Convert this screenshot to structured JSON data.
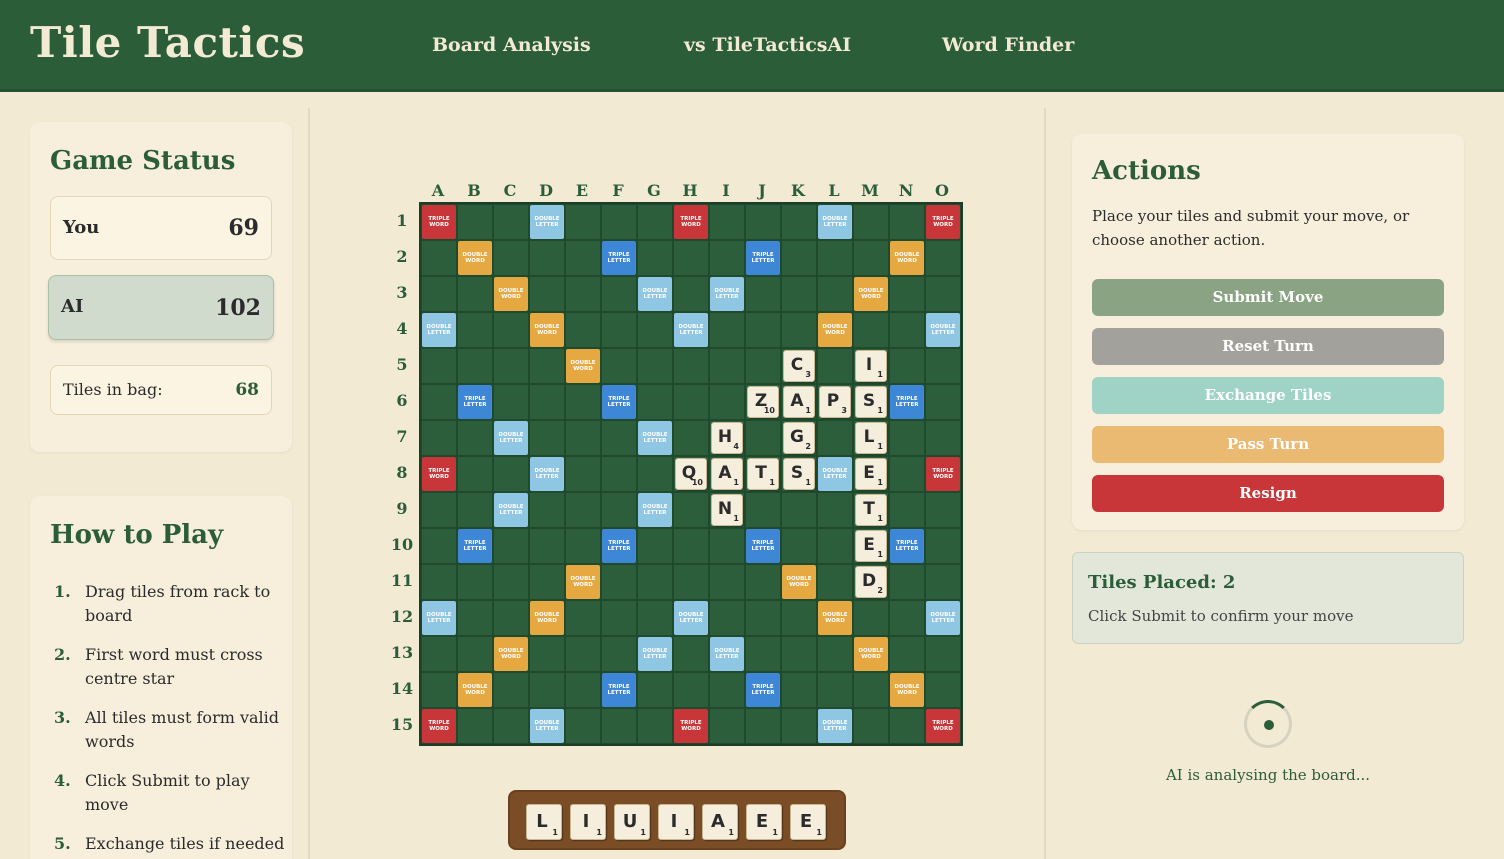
{
  "header": {
    "logo": "Tile Tactics",
    "nav": [
      "Board Analysis",
      "vs TileTacticsAI",
      "Word Finder"
    ]
  },
  "game_status": {
    "title": "Game Status",
    "you_label": "You",
    "you_score": "69",
    "ai_label": "AI",
    "ai_score": "102",
    "bag_label": "Tiles in bag:",
    "bag_count": "68"
  },
  "how_to_play": {
    "title": "How to Play",
    "steps": [
      {
        "num": "1.",
        "text": "Drag tiles from rack to board"
      },
      {
        "num": "2.",
        "text": "First word must cross centre star"
      },
      {
        "num": "3.",
        "text": "All tiles must form valid words"
      },
      {
        "num": "4.",
        "text": "Click Submit to play move"
      },
      {
        "num": "5.",
        "text": "Exchange tiles if needed (lose turn)"
      }
    ]
  },
  "board": {
    "columns": [
      "A",
      "B",
      "C",
      "D",
      "E",
      "F",
      "G",
      "H",
      "I",
      "J",
      "K",
      "L",
      "M",
      "N",
      "O"
    ],
    "rows": [
      "1",
      "2",
      "3",
      "4",
      "5",
      "6",
      "7",
      "8",
      "9",
      "10",
      "11",
      "12",
      "13",
      "14",
      "15"
    ],
    "premium_labels": {
      "TW": [
        "TRIPLE",
        "WORD"
      ],
      "DW": [
        "DOUBLE",
        "WORD"
      ],
      "TL": [
        "TRIPLE",
        "LETTER"
      ],
      "DL": [
        "DOUBLE",
        "LETTER"
      ]
    },
    "premium_colors": {
      "TW": "#c9363a",
      "DW": "#e6a840",
      "TL": "#3e86d6",
      "DL": "#8ec6e4"
    },
    "premium_squares": [
      {
        "cell": "A1",
        "type": "TW"
      },
      {
        "cell": "D1",
        "type": "DL"
      },
      {
        "cell": "H1",
        "type": "TW"
      },
      {
        "cell": "L1",
        "type": "DL"
      },
      {
        "cell": "O1",
        "type": "TW"
      },
      {
        "cell": "B2",
        "type": "DW"
      },
      {
        "cell": "F2",
        "type": "TL"
      },
      {
        "cell": "J2",
        "type": "TL"
      },
      {
        "cell": "N2",
        "type": "DW"
      },
      {
        "cell": "C3",
        "type": "DW"
      },
      {
        "cell": "G3",
        "type": "DL"
      },
      {
        "cell": "I3",
        "type": "DL"
      },
      {
        "cell": "M3",
        "type": "DW"
      },
      {
        "cell": "A4",
        "type": "DL"
      },
      {
        "cell": "D4",
        "type": "DW"
      },
      {
        "cell": "H4",
        "type": "DL"
      },
      {
        "cell": "L4",
        "type": "DW"
      },
      {
        "cell": "O4",
        "type": "DL"
      },
      {
        "cell": "E5",
        "type": "DW"
      },
      {
        "cell": "B6",
        "type": "TL"
      },
      {
        "cell": "F6",
        "type": "TL"
      },
      {
        "cell": "N6",
        "type": "TL"
      },
      {
        "cell": "C7",
        "type": "DL"
      },
      {
        "cell": "G7",
        "type": "DL"
      },
      {
        "cell": "A8",
        "type": "TW"
      },
      {
        "cell": "D8",
        "type": "DL"
      },
      {
        "cell": "L8",
        "type": "DL"
      },
      {
        "cell": "O8",
        "type": "TW"
      },
      {
        "cell": "C9",
        "type": "DL"
      },
      {
        "cell": "G9",
        "type": "DL"
      },
      {
        "cell": "B10",
        "type": "TL"
      },
      {
        "cell": "F10",
        "type": "TL"
      },
      {
        "cell": "J10",
        "type": "TL"
      },
      {
        "cell": "N10",
        "type": "TL"
      },
      {
        "cell": "E11",
        "type": "DW"
      },
      {
        "cell": "K11",
        "type": "DW"
      },
      {
        "cell": "A12",
        "type": "DL"
      },
      {
        "cell": "D12",
        "type": "DW"
      },
      {
        "cell": "H12",
        "type": "DL"
      },
      {
        "cell": "L12",
        "type": "DW"
      },
      {
        "cell": "O12",
        "type": "DL"
      },
      {
        "cell": "C13",
        "type": "DW"
      },
      {
        "cell": "G13",
        "type": "DL"
      },
      {
        "cell": "I13",
        "type": "DL"
      },
      {
        "cell": "M13",
        "type": "DW"
      },
      {
        "cell": "B14",
        "type": "DW"
      },
      {
        "cell": "F14",
        "type": "TL"
      },
      {
        "cell": "J14",
        "type": "TL"
      },
      {
        "cell": "N14",
        "type": "DW"
      },
      {
        "cell": "A15",
        "type": "TW"
      },
      {
        "cell": "D15",
        "type": "DL"
      },
      {
        "cell": "H15",
        "type": "TW"
      },
      {
        "cell": "L15",
        "type": "DL"
      },
      {
        "cell": "O15",
        "type": "TW"
      }
    ],
    "placed_tiles": [
      {
        "cell": "K5",
        "letter": "C",
        "score": "3"
      },
      {
        "cell": "M5",
        "letter": "I",
        "score": "1"
      },
      {
        "cell": "J6",
        "letter": "Z",
        "score": "10"
      },
      {
        "cell": "K6",
        "letter": "A",
        "score": "1"
      },
      {
        "cell": "L6",
        "letter": "P",
        "score": "3"
      },
      {
        "cell": "M6",
        "letter": "S",
        "score": "1"
      },
      {
        "cell": "I7",
        "letter": "H",
        "score": "4"
      },
      {
        "cell": "K7",
        "letter": "G",
        "score": "2"
      },
      {
        "cell": "M7",
        "letter": "L",
        "score": "1"
      },
      {
        "cell": "H8",
        "letter": "Q",
        "score": "10"
      },
      {
        "cell": "I8",
        "letter": "A",
        "score": "1"
      },
      {
        "cell": "J8",
        "letter": "T",
        "score": "1"
      },
      {
        "cell": "K8",
        "letter": "S",
        "score": "1"
      },
      {
        "cell": "M8",
        "letter": "E",
        "score": "1"
      },
      {
        "cell": "I9",
        "letter": "N",
        "score": "1"
      },
      {
        "cell": "M9",
        "letter": "T",
        "score": "1"
      },
      {
        "cell": "M10",
        "letter": "E",
        "score": "1"
      },
      {
        "cell": "M11",
        "letter": "D",
        "score": "2"
      }
    ]
  },
  "rack": [
    {
      "letter": "L",
      "score": "1"
    },
    {
      "letter": "I",
      "score": "1"
    },
    {
      "letter": "U",
      "score": "1"
    },
    {
      "letter": "I",
      "score": "1"
    },
    {
      "letter": "A",
      "score": "1"
    },
    {
      "letter": "E",
      "score": "1"
    },
    {
      "letter": "E",
      "score": "1"
    }
  ],
  "actions": {
    "title": "Actions",
    "description": "Place your tiles and submit your move, or choose another action.",
    "buttons": [
      {
        "label": "Submit Move",
        "color": "#8aa382"
      },
      {
        "label": "Reset Turn",
        "color": "#a3a19b"
      },
      {
        "label": "Exchange Tiles",
        "color": "#9fd3c5"
      },
      {
        "label": "Pass Turn",
        "color": "#ebba72"
      },
      {
        "label": "Resign",
        "color": "#c9363a"
      }
    ]
  },
  "tiles_placed": {
    "title": "Tiles Placed: 2",
    "hint": "Click Submit to confirm your move"
  },
  "ai_status": "AI is analysing the board..."
}
